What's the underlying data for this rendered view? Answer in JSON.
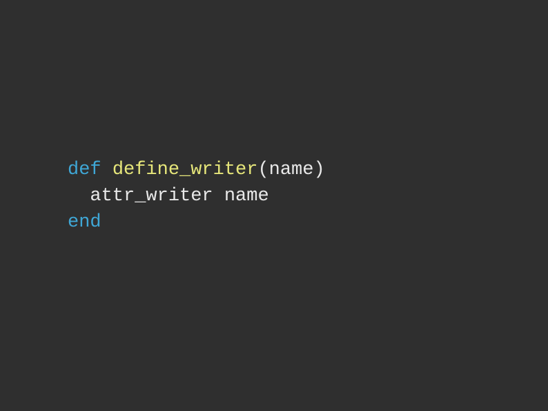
{
  "code": {
    "line1": {
      "keyword": "def",
      "space1": " ",
      "method": "define_writer",
      "params": "(name)"
    },
    "line2": {
      "indent": "  ",
      "content": "attr_writer name"
    },
    "line3": {
      "keyword": "end"
    }
  }
}
